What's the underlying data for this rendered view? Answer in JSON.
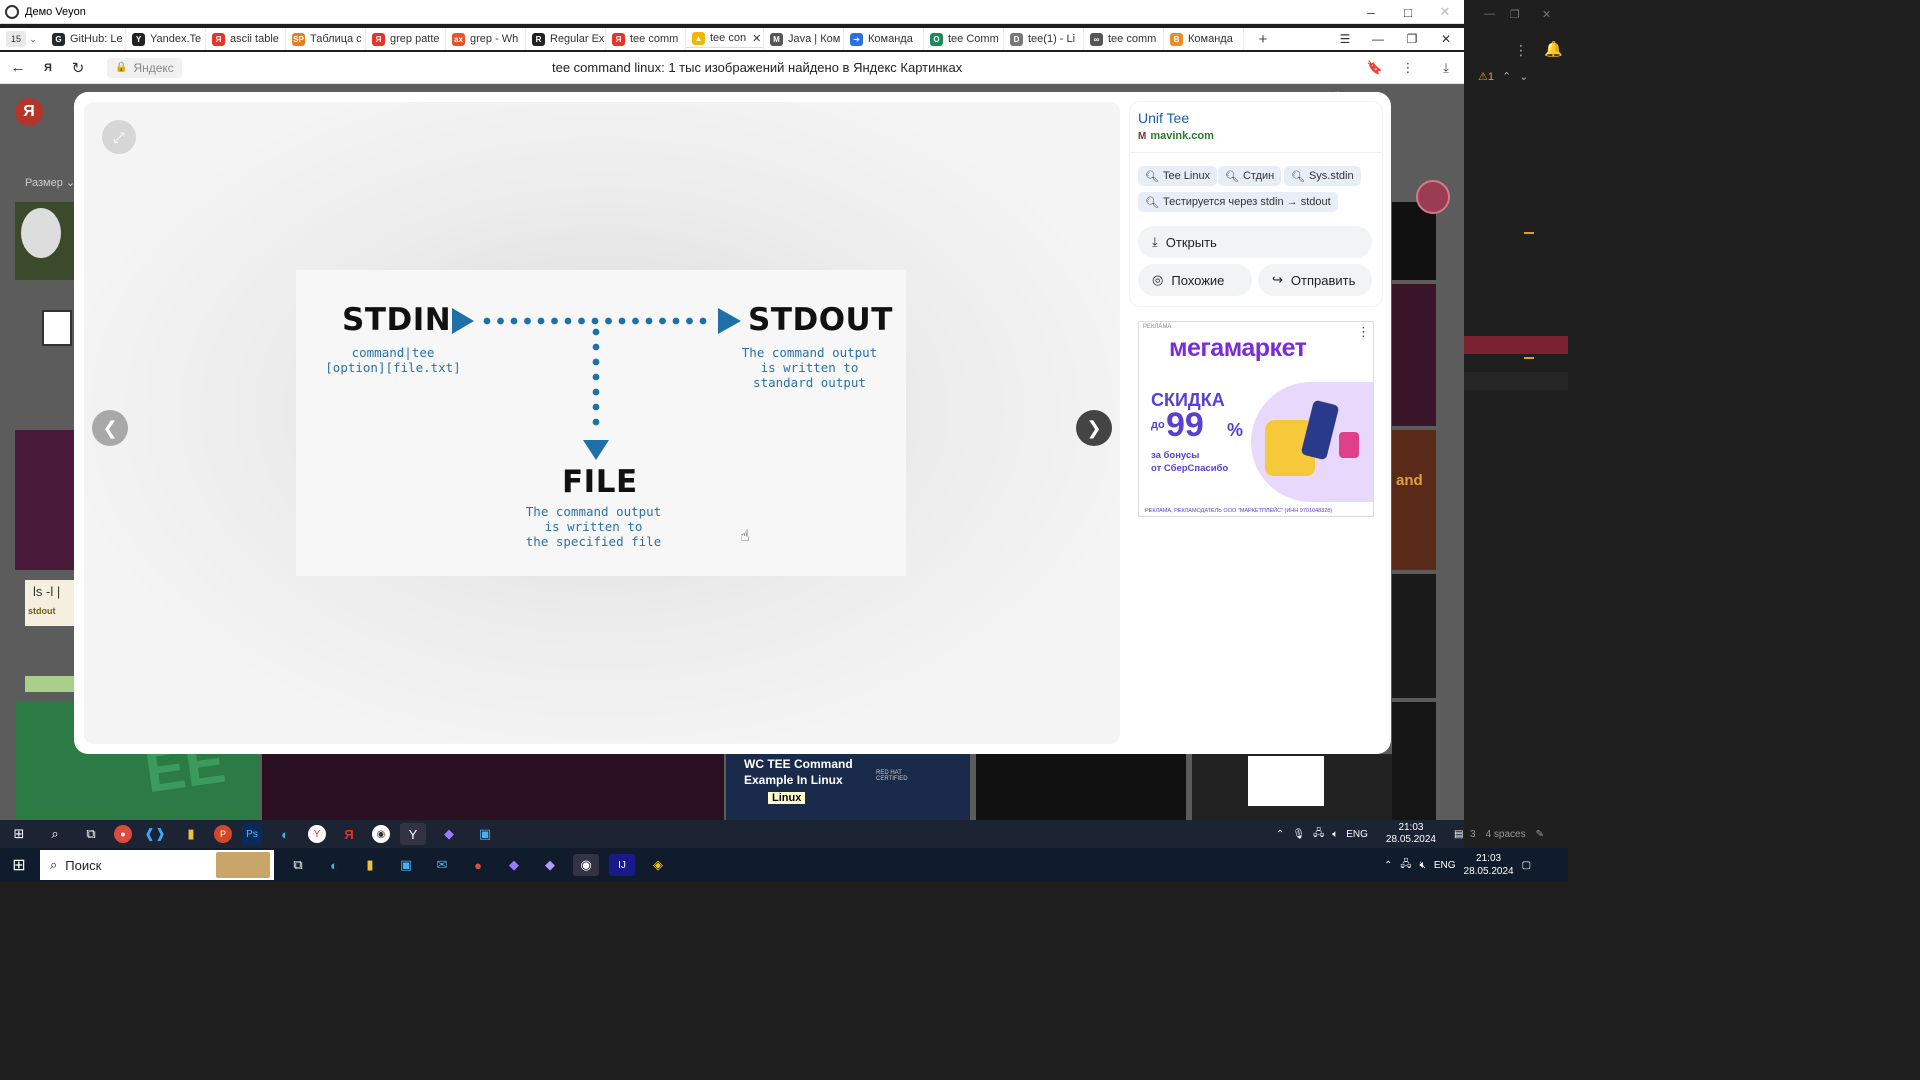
{
  "veyon": {
    "title": "Демо Veyon",
    "minimize": "–",
    "maximize": "□",
    "close": "✕"
  },
  "browser": {
    "tab_count": "15",
    "tabs": [
      {
        "label": "GitHub: Le",
        "color": "#24292e",
        "glyph": "G"
      },
      {
        "label": "Yandex.Te",
        "color": "#222222",
        "glyph": "Y"
      },
      {
        "label": "ascii table",
        "color": "#e2342b",
        "glyph": "Я"
      },
      {
        "label": "Таблица с",
        "color": "#e67e22",
        "glyph": "SP"
      },
      {
        "label": "grep patte",
        "color": "#e2342b",
        "glyph": "Я"
      },
      {
        "label": "grep - Wh",
        "color": "#e2542b",
        "glyph": "ax"
      },
      {
        "label": "Regular Ex",
        "color": "#222222",
        "glyph": "R"
      },
      {
        "label": "tee comm",
        "color": "#e2342b",
        "glyph": "Я"
      },
      {
        "label": "tee con",
        "color": "#f2b705",
        "glyph": "▲",
        "active": true
      },
      {
        "label": "Java | Ком",
        "color": "#555555",
        "glyph": "M"
      },
      {
        "label": "Команда",
        "color": "#2b6fe2",
        "glyph": "➜"
      },
      {
        "label": "tee Comm",
        "color": "#1b8a5a",
        "glyph": "O"
      },
      {
        "label": "tee(1) - Li",
        "color": "#777777",
        "glyph": "D"
      },
      {
        "label": "tee comm",
        "color": "#555555",
        "glyph": "∞"
      },
      {
        "label": "Команда",
        "color": "#f08a24",
        "glyph": "B"
      }
    ],
    "address_host": "Яндекс",
    "page_title": "tee command linux: 1 тыс изображений найдено в Яндекс Картинках"
  },
  "page_behind": {
    "logo": "Я",
    "size_filter": "Размер",
    "ls_text": "ls -l  |",
    "stdout_label": "stdout",
    "wc_card_title": "WC TEE Command Example In Linux",
    "wc_card_badge": "Linux",
    "red_hat_label": "RED HAT CERTIFIED",
    "and_text": "and"
  },
  "modal": {
    "close": "✕",
    "source_title": "Unif Tee",
    "source_domain": "mavink.com",
    "chips": [
      "Tee Linux",
      "Стдин",
      "Sys.stdin",
      "Тестируется через stdin → stdout"
    ],
    "actions": {
      "open": "Открыть",
      "similar": "Похожие",
      "send": "Отправить"
    },
    "ad": {
      "label": "РЕКЛАМА",
      "brand": "мегамаркет",
      "headline": "СКИДКА",
      "prefix": "до",
      "value": "99",
      "unit": "%",
      "line1": "за бонусы",
      "line2": "от СберСпасибо",
      "footer": "РЕКЛАМА, РЕКЛАМОДАТЕЛЬ ООО \"МАРКЕТПЛЕЙС\" (ИНН 9701048328)"
    }
  },
  "diagram": {
    "stdin": "STDIN",
    "stdout": "STDOUT",
    "file": "FILE",
    "stdin_desc": "command|tee\n[option][file.txt]",
    "stdout_desc": "The command output\nis written to\nstandard output",
    "file_desc": "The command output\nis written to\nthe specified file",
    "accent": "#1f6fa8"
  },
  "taskbar_inner": {
    "time": "21:03",
    "date": "28.05.2024",
    "lang": "ENG"
  },
  "taskbar_outer": {
    "search_placeholder": "Поиск",
    "time": "21:03",
    "date": "28.05.2024",
    "lang": "ENG"
  },
  "remote_side": {
    "warn": "⚠1",
    "status": "4 spaces"
  }
}
